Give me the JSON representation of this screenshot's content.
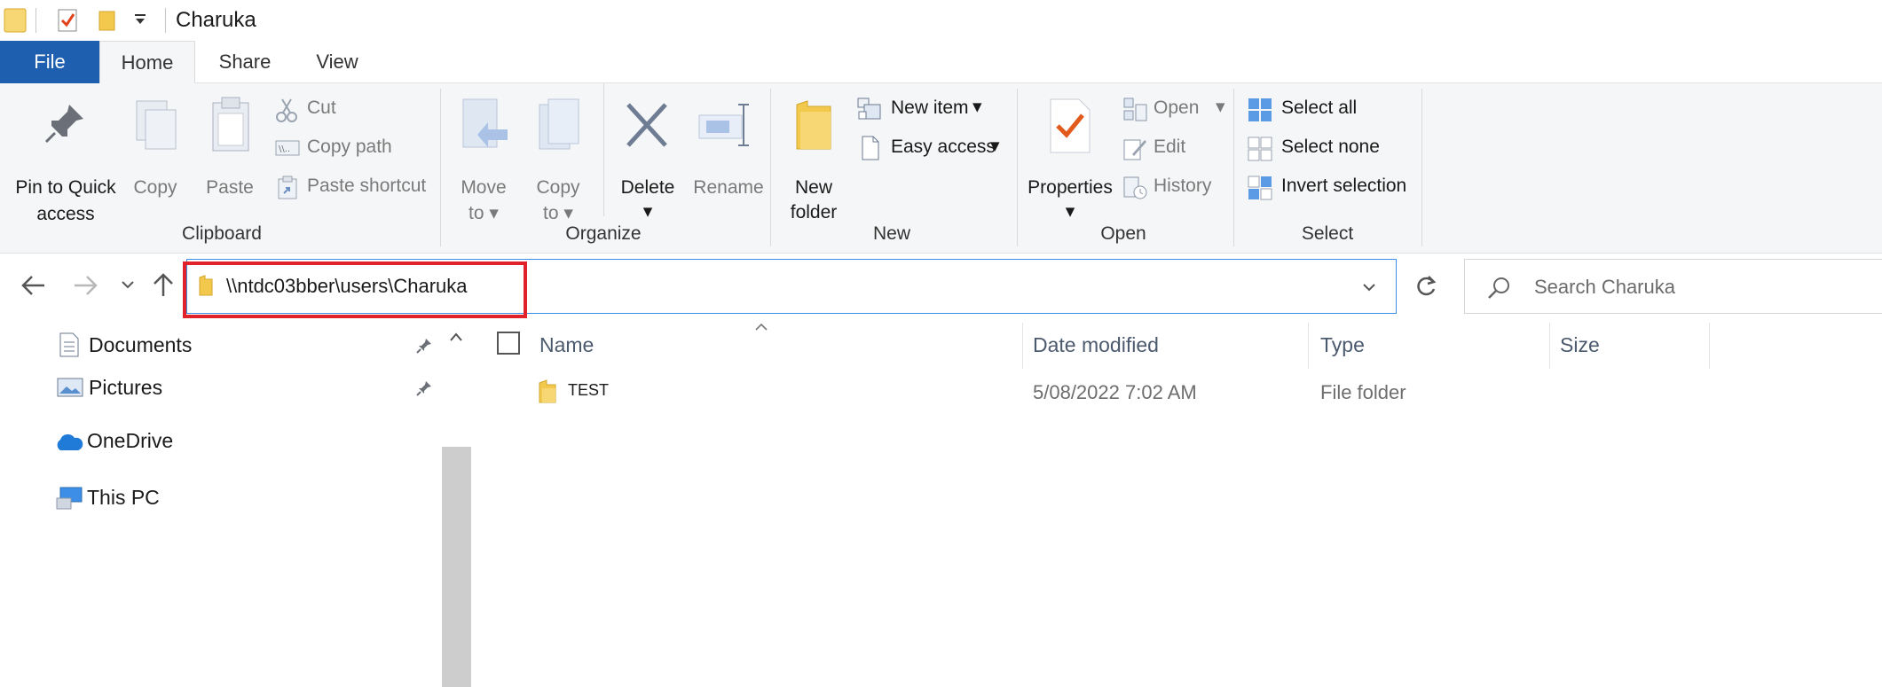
{
  "window": {
    "title": "Charuka",
    "quick_access_icons": [
      "folder-icon",
      "properties-check-icon",
      "new-folder-icon",
      "customize-dropdown-icon"
    ]
  },
  "ribbon_tabs": [
    {
      "label": "File"
    },
    {
      "label": "Home"
    },
    {
      "label": "Share"
    },
    {
      "label": "View"
    }
  ],
  "ribbon": {
    "clipboard": {
      "pin_label_1": "Pin to Quick",
      "pin_label_2": "access",
      "copy": "Copy",
      "paste": "Paste",
      "cut": "Cut",
      "copy_path": "Copy path",
      "paste_shortcut": "Paste shortcut",
      "group": "Clipboard"
    },
    "organize": {
      "move_1": "Move",
      "move_2": "to",
      "copy_1": "Copy",
      "copy_2": "to",
      "delete": "Delete",
      "rename": "Rename",
      "group": "Organize"
    },
    "new": {
      "new_folder_1": "New",
      "new_folder_2": "folder",
      "new_item": "New item",
      "easy_access": "Easy access",
      "group": "New"
    },
    "open": {
      "properties": "Properties",
      "open": "Open",
      "edit": "Edit",
      "history": "History",
      "group": "Open"
    },
    "select": {
      "select_all": "Select all",
      "select_none": "Select none",
      "invert": "Invert selection",
      "group": "Select"
    }
  },
  "address": {
    "path": "\\\\ntdc03bber\\users\\Charuka",
    "search_placeholder": "Search Charuka"
  },
  "nav_pane": {
    "items": [
      {
        "label": "Documents",
        "icon": "documents-icon",
        "pinned": true
      },
      {
        "label": "Pictures",
        "icon": "pictures-icon",
        "pinned": true
      },
      {
        "label": "OneDrive",
        "icon": "onedrive-icon",
        "pinned": false
      },
      {
        "label": "This PC",
        "icon": "this-pc-icon",
        "pinned": false
      }
    ]
  },
  "file_list": {
    "columns": [
      "Name",
      "Date modified",
      "Type",
      "Size"
    ],
    "rows": [
      {
        "name": "TEST",
        "date_modified": "5/08/2022 7:02 AM",
        "type": "File folder",
        "size": ""
      }
    ]
  },
  "colors": {
    "accent": "#1f5faf",
    "highlight_box": "#e2222a",
    "address_border": "#3d8ee6",
    "folder_yellow": "#f2c94c"
  }
}
